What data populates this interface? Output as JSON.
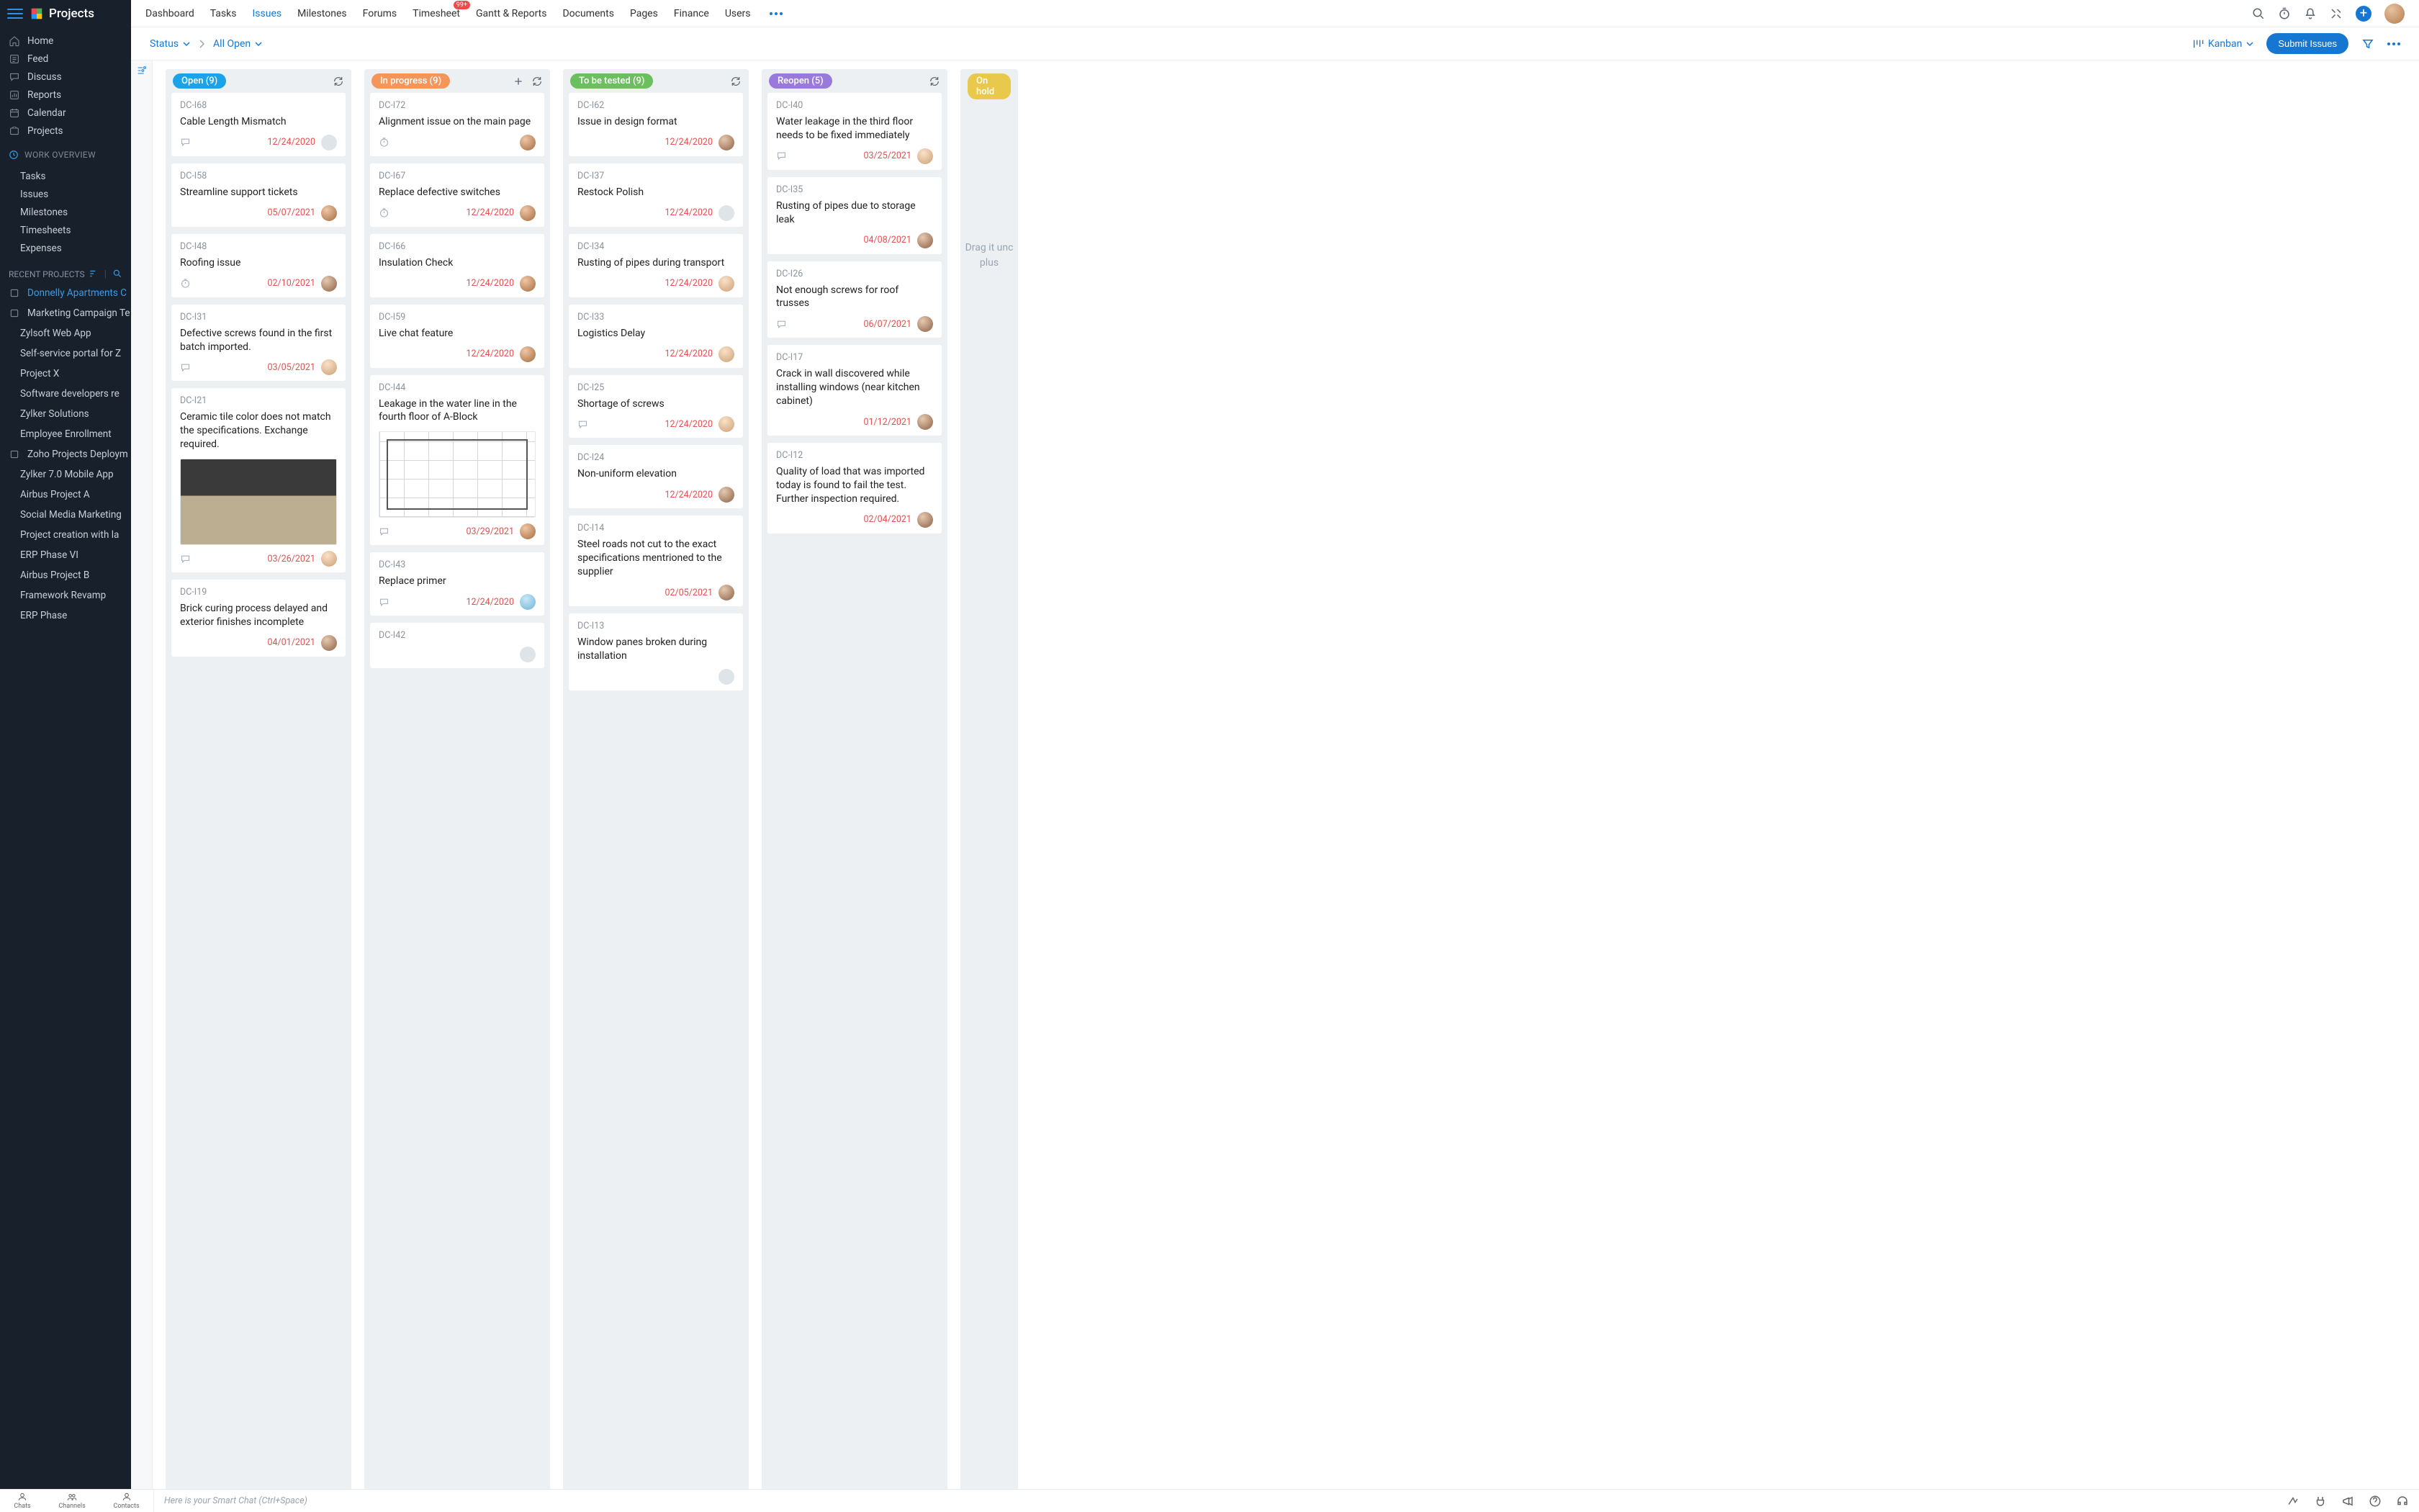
{
  "brand": "Projects",
  "sidebar": {
    "primary": [
      {
        "icon": "home",
        "label": "Home"
      },
      {
        "icon": "feed",
        "label": "Feed"
      },
      {
        "icon": "discuss",
        "label": "Discuss"
      },
      {
        "icon": "reports",
        "label": "Reports"
      },
      {
        "icon": "calendar",
        "label": "Calendar"
      },
      {
        "icon": "projects",
        "label": "Projects"
      }
    ],
    "overview_heading": "WORK OVERVIEW",
    "overview": [
      {
        "label": "Tasks"
      },
      {
        "label": "Issues"
      },
      {
        "label": "Milestones"
      },
      {
        "label": "Timesheets"
      },
      {
        "label": "Expenses"
      }
    ],
    "recent_heading": "RECENT PROJECTS",
    "recent": [
      {
        "label": "Donnelly Apartments C",
        "active": true,
        "icon": true
      },
      {
        "label": "Marketing Campaign Te",
        "icon": true
      },
      {
        "label": "Zylsoft Web App"
      },
      {
        "label": "Self-service portal for Z"
      },
      {
        "label": "Project X"
      },
      {
        "label": "Software developers re"
      },
      {
        "label": "Zylker Solutions"
      },
      {
        "label": "Employee Enrollment"
      },
      {
        "label": "Zoho Projects Deploym",
        "icon": true
      },
      {
        "label": "Zylker 7.0 Mobile App"
      },
      {
        "label": "Airbus Project A"
      },
      {
        "label": "Social Media Marketing"
      },
      {
        "label": "Project creation with la"
      },
      {
        "label": "ERP Phase VI"
      },
      {
        "label": "Airbus Project B"
      },
      {
        "label": "Framework Revamp"
      },
      {
        "label": "ERP Phase"
      }
    ]
  },
  "topnav": {
    "tabs": [
      "Dashboard",
      "Tasks",
      "Issues",
      "Milestones",
      "Forums",
      "Timesheet",
      "Gantt & Reports",
      "Documents",
      "Pages",
      "Finance",
      "Users"
    ],
    "active": "Issues",
    "timesheet_badge": "99+"
  },
  "subbar": {
    "crumb1": "Status",
    "crumb2": "All Open",
    "view_label": "Kanban",
    "submit_label": "Submit Issues"
  },
  "board": {
    "columns": [
      {
        "title": "Open (9)",
        "color": "#1aa3e8",
        "showPlus": false,
        "cards": [
          {
            "id": "DC-I68",
            "title": "Cable Length Mismatch",
            "icons": [
              "comment"
            ],
            "date": "12/24/2020",
            "asg": ""
          },
          {
            "id": "DC-I58",
            "title": "Streamline support tickets",
            "icons": [],
            "date": "05/07/2021",
            "asg": "a1"
          },
          {
            "id": "DC-I48",
            "title": "Roofing issue",
            "icons": [
              "clock"
            ],
            "date": "02/10/2021",
            "asg": "a2"
          },
          {
            "id": "DC-I31",
            "title": "Defective screws found in the first batch imported.",
            "icons": [
              "comment"
            ],
            "date": "03/05/2021",
            "asg": "a3"
          },
          {
            "id": "DC-I21",
            "title": "Ceramic tile color does not match the specifications. Exchange required.",
            "icons": [
              "comment"
            ],
            "date": "03/26/2021",
            "asg": "a3",
            "image": "tile"
          },
          {
            "id": "DC-I19",
            "title": "Brick curing process delayed and exterior finishes incomplete",
            "icons": [],
            "date": "04/01/2021",
            "asg": "a2"
          }
        ]
      },
      {
        "title": "In progress (9)",
        "color": "#f4955a",
        "showPlus": true,
        "cards": [
          {
            "id": "DC-I72",
            "title": "Alignment issue on the main page",
            "icons": [
              "clock"
            ],
            "date": "",
            "asg": "a1"
          },
          {
            "id": "DC-I67",
            "title": "Replace defective switches",
            "icons": [
              "clock"
            ],
            "date": "12/24/2020",
            "asg": "a1"
          },
          {
            "id": "DC-I66",
            "title": "Insulation Check",
            "icons": [],
            "date": "12/24/2020",
            "asg": "a1"
          },
          {
            "id": "DC-I59",
            "title": "Live chat feature",
            "icons": [],
            "date": "12/24/2020",
            "asg": "a1"
          },
          {
            "id": "DC-I44",
            "title": "Leakage in the water line in the fourth floor of A-Block",
            "icons": [
              "comment"
            ],
            "date": "03/29/2021",
            "asg": "a1",
            "image": "plan"
          },
          {
            "id": "DC-I43",
            "title": "Replace primer",
            "icons": [
              "comment"
            ],
            "date": "12/24/2020",
            "asg": "a4"
          },
          {
            "id": "DC-I42",
            "title": "",
            "icons": [],
            "date": "",
            "asg": ""
          }
        ]
      },
      {
        "title": "To be tested (9)",
        "color": "#6bbf5e",
        "showPlus": false,
        "cards": [
          {
            "id": "DC-I62",
            "title": "Issue in design format",
            "icons": [],
            "date": "12/24/2020",
            "asg": "a2"
          },
          {
            "id": "DC-I37",
            "title": "Restock Polish",
            "icons": [],
            "date": "12/24/2020",
            "asg": ""
          },
          {
            "id": "DC-I34",
            "title": "Rusting of pipes during transport",
            "icons": [],
            "date": "12/24/2020",
            "asg": "a3"
          },
          {
            "id": "DC-I33",
            "title": "Logistics Delay",
            "icons": [],
            "date": "12/24/2020",
            "asg": "a3"
          },
          {
            "id": "DC-I25",
            "title": "Shortage of screws",
            "icons": [
              "comment"
            ],
            "date": "12/24/2020",
            "asg": "a3"
          },
          {
            "id": "DC-I24",
            "title": "Non-uniform elevation",
            "icons": [],
            "date": "12/24/2020",
            "asg": "a2"
          },
          {
            "id": "DC-I14",
            "title": "Steel roads not cut to the exact specifications mentrioned to the supplier",
            "icons": [],
            "date": "02/05/2021",
            "asg": "a2"
          },
          {
            "id": "DC-I13",
            "title": "Window panes broken during installation",
            "icons": [],
            "date": "",
            "asg": ""
          }
        ]
      },
      {
        "title": "Reopen (5)",
        "color": "#9a79dd",
        "showPlus": false,
        "cards": [
          {
            "id": "DC-I40",
            "title": "Water leakage in the third floor needs to be fixed immediately",
            "icons": [
              "comment"
            ],
            "date": "03/25/2021",
            "asg": "a3"
          },
          {
            "id": "DC-I35",
            "title": "Rusting of pipes due to storage leak",
            "icons": [],
            "date": "04/08/2021",
            "asg": "a2"
          },
          {
            "id": "DC-I26",
            "title": "Not enough screws for roof trusses",
            "icons": [
              "comment"
            ],
            "date": "06/07/2021",
            "asg": "a2"
          },
          {
            "id": "DC-I17",
            "title": "Crack in wall discovered while installing windows (near kitchen cabinet)",
            "icons": [],
            "date": "01/12/2021",
            "asg": "a2"
          },
          {
            "id": "DC-I12",
            "title": "Quality of load that was imported today is found to fail the test. Further inspection required.",
            "icons": [],
            "date": "02/04/2021",
            "asg": "a2"
          }
        ]
      },
      {
        "title": "On hold",
        "color": "#e8c94c",
        "showPlus": false,
        "partial": true,
        "cards": []
      }
    ],
    "drop_hint": "Drag it unc plus"
  },
  "bottombar": {
    "dock": [
      "Chats",
      "Channels",
      "Contacts"
    ],
    "smart_chat_placeholder": "Here is your Smart Chat (Ctrl+Space)"
  }
}
